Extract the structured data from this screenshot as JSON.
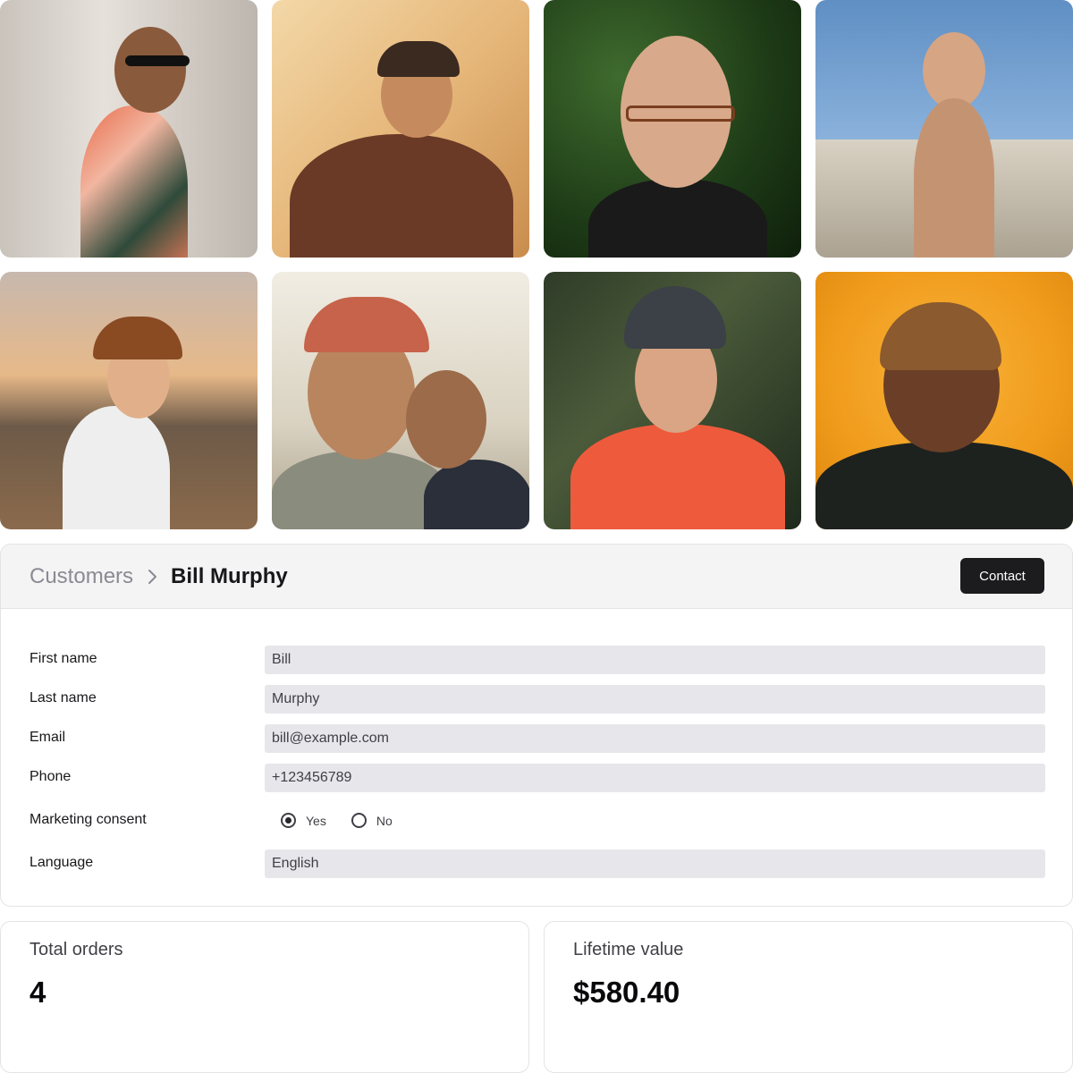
{
  "photos": [
    {
      "alt": "customer-photo-1"
    },
    {
      "alt": "customer-photo-2"
    },
    {
      "alt": "customer-photo-3"
    },
    {
      "alt": "customer-photo-4"
    },
    {
      "alt": "customer-photo-5"
    },
    {
      "alt": "customer-photo-6"
    },
    {
      "alt": "customer-photo-7"
    },
    {
      "alt": "customer-photo-8"
    }
  ],
  "breadcrumb": {
    "parent": "Customers",
    "separator_icon": "chevron-right-icon",
    "current": "Bill Murphy"
  },
  "header": {
    "contact_label": "Contact"
  },
  "form": {
    "first_name": {
      "label": "First name",
      "value": "Bill"
    },
    "last_name": {
      "label": "Last name",
      "value": "Murphy"
    },
    "email": {
      "label": "Email",
      "value": "bill@example.com"
    },
    "phone": {
      "label": "Phone",
      "value": "+123456789"
    },
    "marketing_consent": {
      "label": "Marketing consent",
      "options": [
        "Yes",
        "No"
      ],
      "selected": "Yes"
    },
    "language": {
      "label": "Language",
      "value": "English"
    }
  },
  "stats": {
    "total_orders": {
      "label": "Total orders",
      "value": "4"
    },
    "lifetime_value": {
      "label": "Lifetime value",
      "value": "$580.40"
    }
  },
  "colors": {
    "header_bg": "#f4f4f5",
    "field_bg": "#e7e6ea",
    "button_bg": "#1c1c1f",
    "border": "#e4e4e7"
  }
}
